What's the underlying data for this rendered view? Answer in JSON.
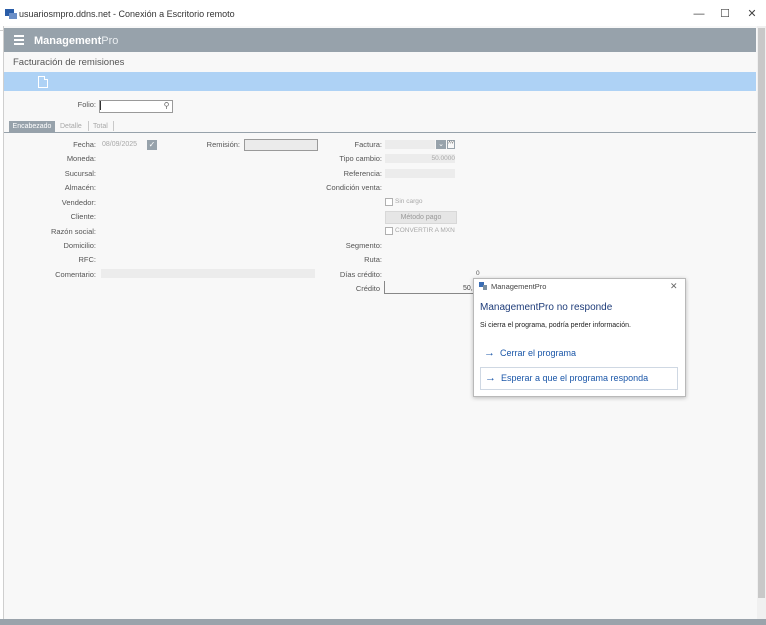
{
  "remote": {
    "title": "usuariosmpro.ddns.net - Conexión a Escritorio remoto",
    "minimize": "—",
    "maximize": "☐",
    "close": "✕"
  },
  "app": {
    "brand_main": "Management",
    "brand_pro": "Pro",
    "page_title": "Facturación de remisiones"
  },
  "form": {
    "folio_label": "Folio:",
    "tabs": [
      "Encabezado",
      "Detalle",
      "Total"
    ],
    "labels": {
      "fecha": "Fecha:",
      "moneda": "Moneda:",
      "sucursal": "Sucursal:",
      "almacen": "Almacén:",
      "vendedor": "Vendedor:",
      "cliente": "Cliente:",
      "razon_social": "Razón social:",
      "domicilio": "Domicilio:",
      "rfc": "RFC:",
      "comentario": "Comentario:",
      "remision": "Remisión:",
      "factura": "Factura:",
      "tipo_cambio": "Tipo cambio:",
      "referencia": "Referencia:",
      "condicion_venta": "Condición venta:",
      "segmento": "Segmento:",
      "ruta": "Ruta:",
      "dias_credito": "Días crédito:",
      "credito": "Crédito"
    },
    "values": {
      "fecha": "08/09/2025",
      "tipo_cambio": "50.0000",
      "dias_credito": "0",
      "credito": "50,"
    },
    "sin_cargo_label": "Sin cargo",
    "metodo_pago_label": "Método pago",
    "convertir_label": "CONVERTIR A MXN"
  },
  "dialog": {
    "app_name": "ManagementPro",
    "close": "✕",
    "heading": "ManagementPro no responde",
    "message": "Si cierra el programa, podría perder información.",
    "option_close": "Cerrar el programa",
    "option_wait": "Esperar a que el programa responda",
    "arrow": "→"
  }
}
